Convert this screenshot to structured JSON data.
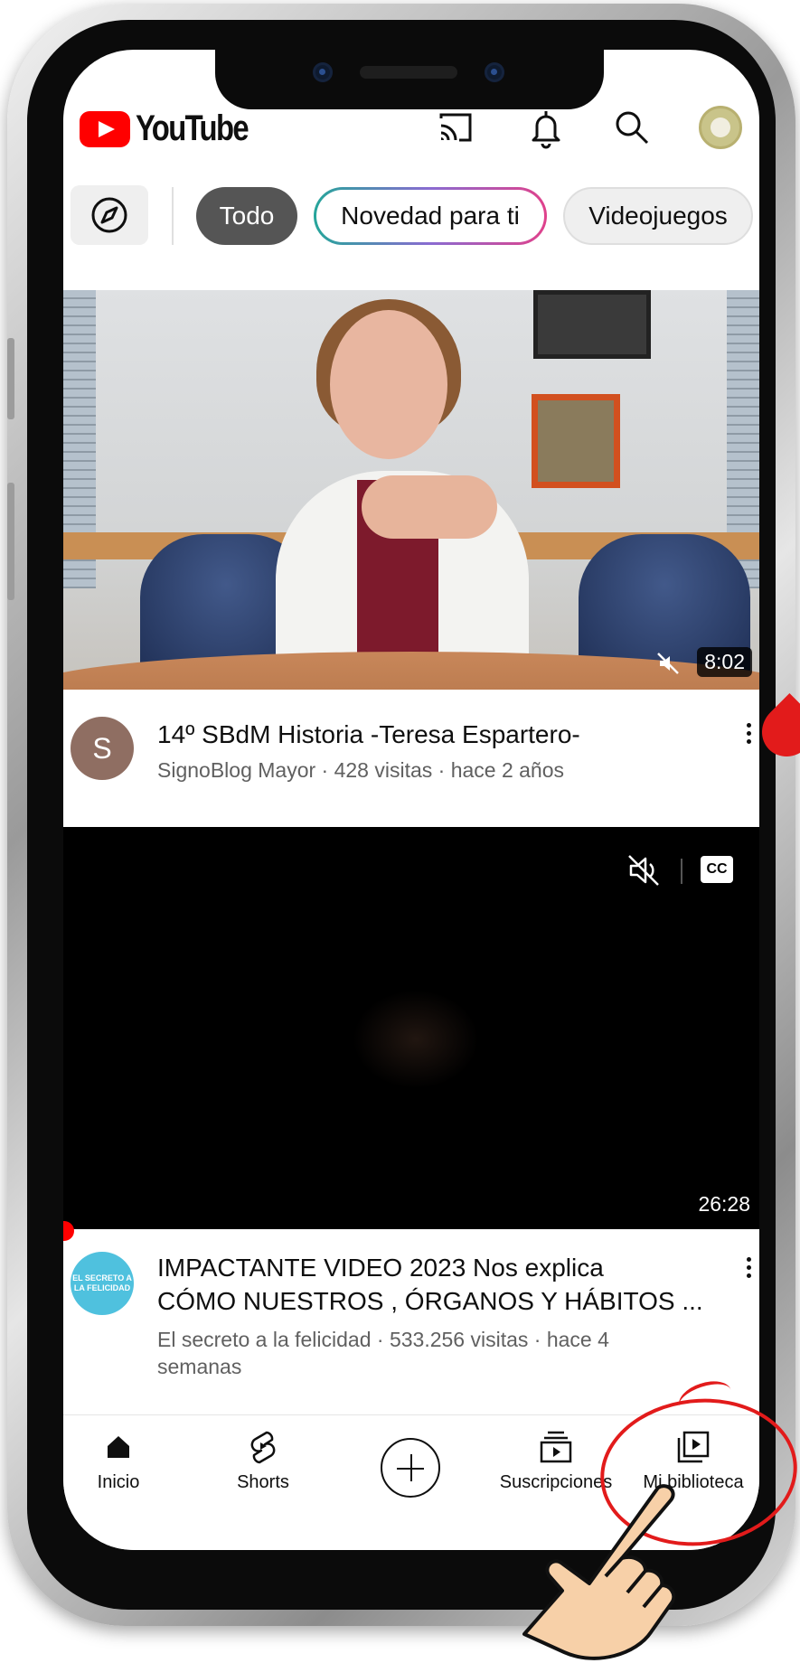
{
  "header": {
    "logo_text": "YouTube",
    "icons": [
      "cast-icon",
      "bell-icon",
      "search-icon",
      "avatar"
    ]
  },
  "chips": {
    "items": [
      "Todo",
      "Novedad para ti",
      "Videojuegos"
    ],
    "selected": "Todo"
  },
  "videos": [
    {
      "duration": "8:02",
      "channel_initial": "S",
      "title": "14º SBdM Historia -Teresa Espartero-",
      "subtitle": "SignoBlog Mayor · 428 visitas · hace 2 años"
    },
    {
      "duration": "26:28",
      "channel_logo_text": "EL SECRETO A LA FELICIDAD",
      "title_line1": "IMPACTANTE VIDEO 2023 Nos explica",
      "title_line2": "CÓMO NUESTROS , ÓRGANOS Y HÁBITOS ...",
      "subtitle_line1": "El secreto a la felicidad · 533.256 visitas · hace 4",
      "subtitle_line2": "semanas",
      "cc_label": "CC"
    }
  ],
  "bottom_nav": {
    "home": "Inicio",
    "shorts": "Shorts",
    "subscriptions": "Suscripciones",
    "library": "Mi biblioteca"
  },
  "colors": {
    "brand_red": "#ff0000",
    "annotation_red": "#e21b1b",
    "text_primary": "#0f0f0f",
    "text_secondary": "#606060"
  }
}
